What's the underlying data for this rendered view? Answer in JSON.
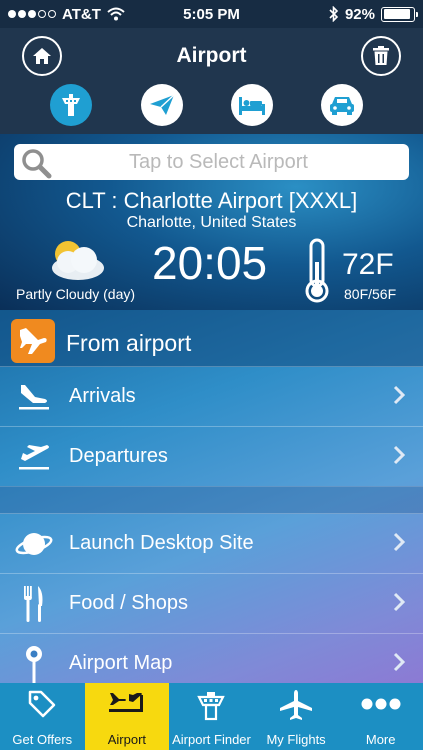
{
  "status_bar": {
    "carrier": "AT&T",
    "time": "5:05 PM",
    "battery": "92%",
    "battery_level": 0.92
  },
  "header": {
    "title": "Airport"
  },
  "categories": [
    {
      "name": "tower-icon",
      "active": true
    },
    {
      "name": "paper-plane-icon",
      "active": false
    },
    {
      "name": "bed-icon",
      "active": false
    },
    {
      "name": "car-icon",
      "active": false
    }
  ],
  "search": {
    "placeholder": "Tap to Select Airport"
  },
  "airport": {
    "name": "CLT : Charlotte Airport [XXXL]",
    "city": "Charlotte, United States",
    "weather": "Partly Cloudy (day)",
    "local_time": "20:05",
    "temperature": "72F",
    "temp_range": "80F/56F"
  },
  "section": {
    "title": "From airport"
  },
  "menu": {
    "arrivals": "Arrivals",
    "departures": "Departures",
    "desktop": "Launch Desktop Site",
    "food": "Food / Shops",
    "map": "Airport Map"
  },
  "tabs": {
    "offers": "Get Offers",
    "airport": "Airport",
    "finder": "Airport Finder",
    "flights": "My Flights",
    "more": "More"
  },
  "colors": {
    "accent": "#1f9fd2",
    "tab_active": "#f7d90f",
    "badge": "#f08a1f"
  }
}
